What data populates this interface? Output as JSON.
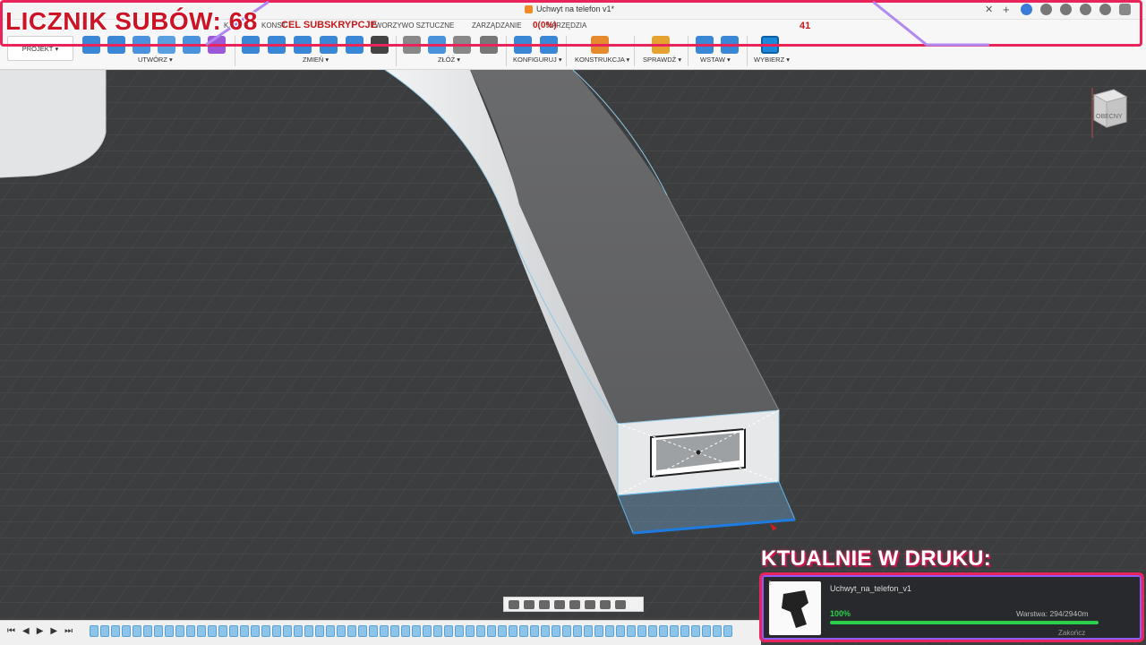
{
  "window": {
    "document_title": "Uchwyt na telefon v1*"
  },
  "ribbon": {
    "tabs": [
      "KA",
      "KONST",
      "TWORZYWO SZTUCZNE",
      "ZARZĄDZANIE",
      "NARZĘDZIA"
    ],
    "project_button": "PROJEKT",
    "groups": [
      "UTWÓRZ",
      "ZMIEŃ",
      "ZŁÓŻ",
      "KONFIGURUJ",
      "KONSTRUKCJA",
      "SPRAWDŹ",
      "WSTAW",
      "WYBIERZ"
    ]
  },
  "overlay": {
    "subs_counter": "LICZNIK SUBÓW: 68",
    "goal_label": "CEL SUBSKRYPCJE",
    "goal_progress": "0(0%)",
    "goal_target": "41",
    "accent_pink": "#e8245a",
    "accent_purple": "#8b5cf6"
  },
  "viewcube": {
    "label": "OBECNY"
  },
  "printing": {
    "heading": "KTUALNIE W DRUKU:",
    "index": "1",
    "file_name": "Uchwyt_na_telefon_v1",
    "percent": "100%",
    "progress_fraction": 1.0,
    "layer": "Warstwa: 294/294",
    "remaining": "-0m",
    "finish": "Zakończ"
  }
}
